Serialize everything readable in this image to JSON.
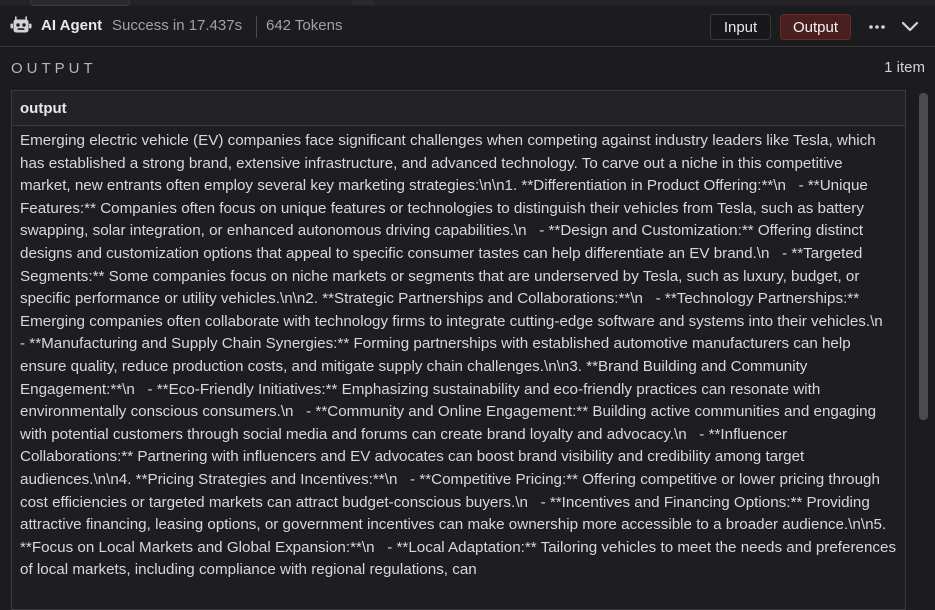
{
  "header": {
    "agent_name": "AI Agent",
    "status": "Success in 17.437s",
    "tokens": "642 Tokens",
    "input_label": "Input",
    "output_label": "Output"
  },
  "section": {
    "title": "OUTPUT",
    "count": "1 item"
  },
  "panel": {
    "field_name": "output",
    "text": "Emerging electric vehicle (EV) companies face significant challenges when competing against industry leaders like Tesla, which has established a strong brand, extensive infrastructure, and advanced technology. To carve out a niche in this competitive market, new entrants often employ several key marketing strategies:\\n\\n1. **Differentiation in Product Offering:**\\n   - **Unique Features:** Companies often focus on unique features or technologies to distinguish their vehicles from Tesla, such as battery swapping, solar integration, or enhanced autonomous driving capabilities.\\n   - **Design and Customization:** Offering distinct designs and customization options that appeal to specific consumer tastes can help differentiate an EV brand.\\n   - **Targeted Segments:** Some companies focus on niche markets or segments that are underserved by Tesla, such as luxury, budget, or specific performance or utility vehicles.\\n\\n2. **Strategic Partnerships and Collaborations:**\\n   - **Technology Partnerships:** Emerging companies often collaborate with technology firms to integrate cutting-edge software and systems into their vehicles.\\n   - **Manufacturing and Supply Chain Synergies:** Forming partnerships with established automotive manufacturers can help ensure quality, reduce production costs, and mitigate supply chain challenges.\\n\\n3. **Brand Building and Community Engagement:**\\n   - **Eco-Friendly Initiatives:** Emphasizing sustainability and eco-friendly practices can resonate with environmentally conscious consumers.\\n   - **Community and Online Engagement:** Building active communities and engaging with potential customers through social media and forums can create brand loyalty and advocacy.\\n   - **Influencer Collaborations:** Partnering with influencers and EV advocates can boost brand visibility and credibility among target audiences.\\n\\n4. **Pricing Strategies and Incentives:**\\n   - **Competitive Pricing:** Offering competitive or lower pricing through cost efficiencies or targeted markets can attract budget-conscious buyers.\\n   - **Incentives and Financing Options:** Providing attractive financing, leasing options, or government incentives can make ownership more accessible to a broader audience.\\n\\n5. **Focus on Local Markets and Global Expansion:**\\n   - **Local Adaptation:** Tailoring vehicles to meet the needs and preferences of local markets, including compliance with regional regulations, can"
  },
  "icons": {
    "agent": "robot-icon",
    "more": "more-horizontal-icon",
    "collapse": "chevron-down-icon"
  },
  "colors": {
    "background": "#1c1c1f",
    "output_button": "#4a1f1f",
    "text": "#d8d8dc"
  }
}
